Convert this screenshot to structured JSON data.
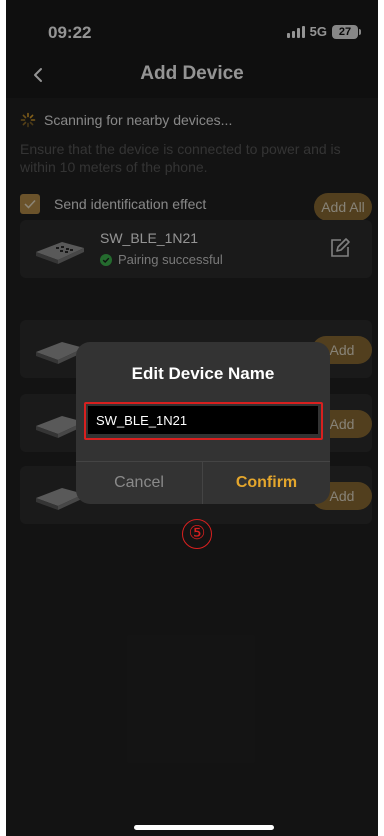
{
  "status_bar": {
    "time": "09:22",
    "network": "5G",
    "battery": "27"
  },
  "nav": {
    "title": "Add Device",
    "back_icon": "chevron-left-icon"
  },
  "scan": {
    "text": "Scanning for nearby devices...",
    "hint": "Ensure that the device is connected to power and is within 10 meters of the phone.",
    "icon": "spinner-icon"
  },
  "identification": {
    "label": "Send identification effect",
    "checked": true,
    "add_all": "Add All"
  },
  "devices": [
    {
      "name": "SW_BLE_1N21",
      "status": "Pairing successful",
      "action": "edit"
    },
    {
      "name": "",
      "action_label": "Add"
    },
    {
      "name": "",
      "action_label": "Add"
    },
    {
      "name": "",
      "action_label": "Add"
    }
  ],
  "dialog": {
    "title": "Edit Device Name",
    "input_value": "SW_BLE_1N21",
    "cancel": "Cancel",
    "confirm": "Confirm"
  },
  "annotation": {
    "step_marker": "⑤"
  },
  "colors": {
    "accent": "#e4a62c",
    "gold_button": "#8d6d34",
    "success": "#3fb950",
    "highlight": "#d8201f"
  }
}
